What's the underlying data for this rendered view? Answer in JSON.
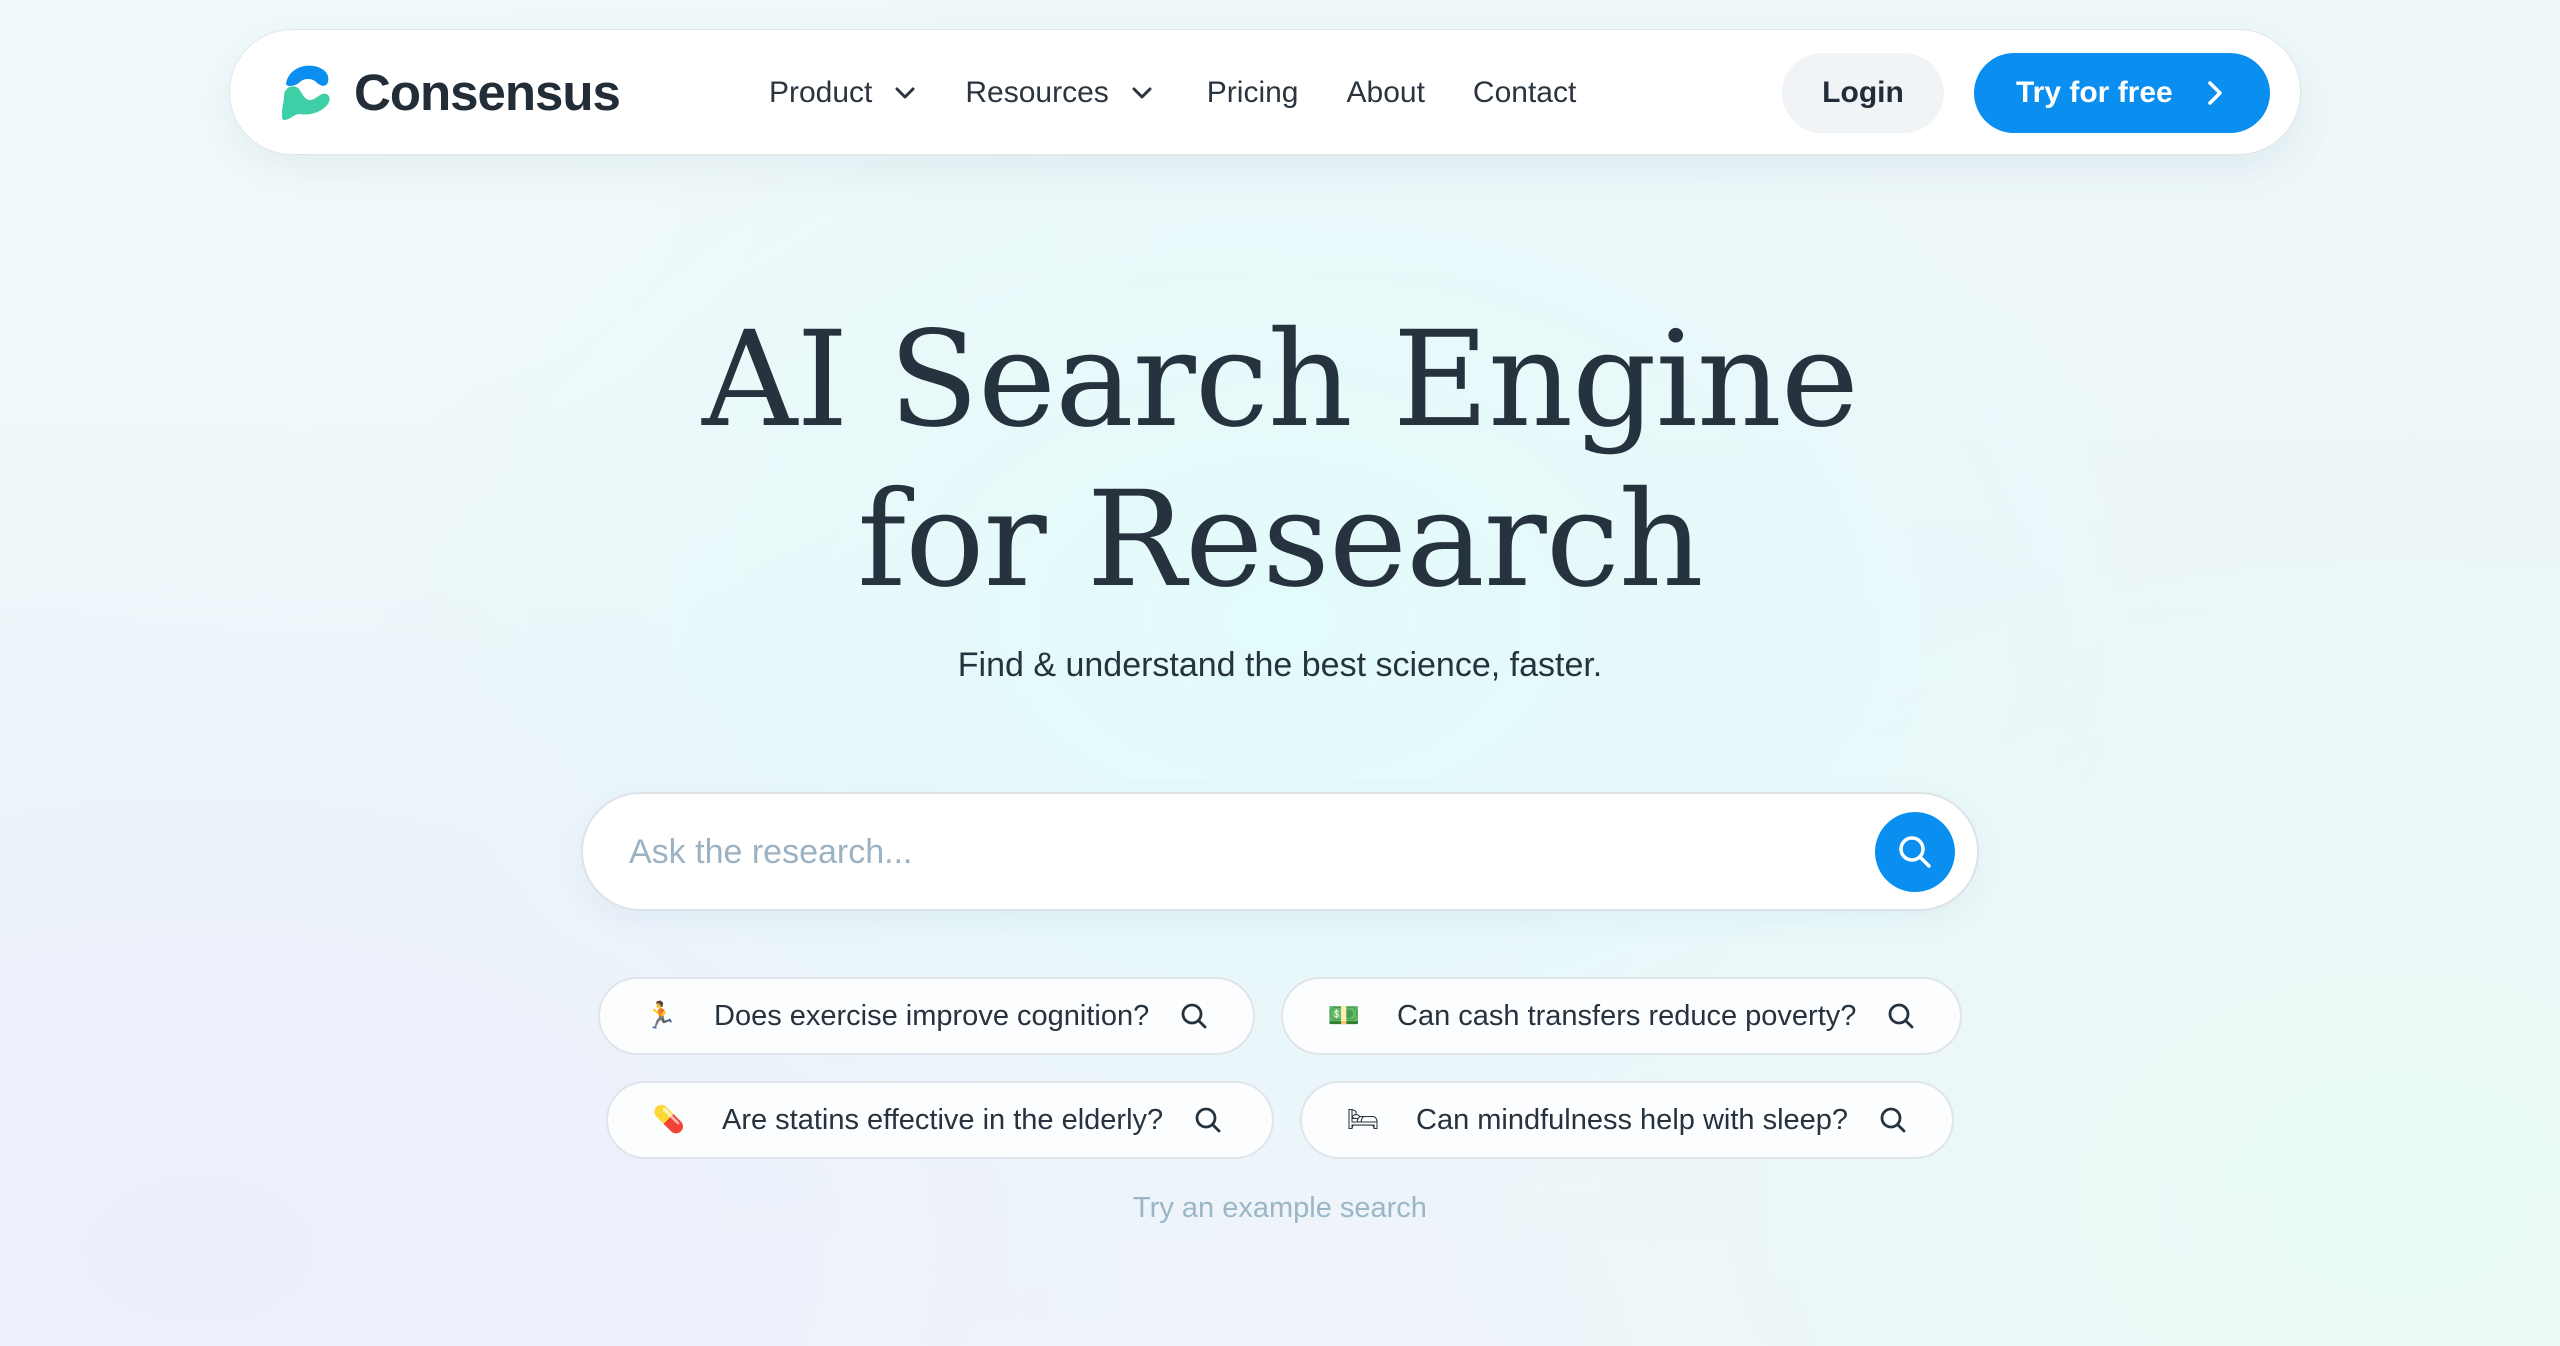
{
  "brand": {
    "name": "Consensus",
    "colors": {
      "primary": "#0a8ff0",
      "logo_blue": "#0a8ff0",
      "logo_green": "#3ecfa6",
      "text_dark": "#222d38"
    }
  },
  "nav": {
    "links": [
      {
        "label": "Product",
        "has_dropdown": true
      },
      {
        "label": "Resources",
        "has_dropdown": true
      },
      {
        "label": "Pricing",
        "has_dropdown": false
      },
      {
        "label": "About",
        "has_dropdown": false
      },
      {
        "label": "Contact",
        "has_dropdown": false
      }
    ],
    "login_label": "Login",
    "cta_label": "Try for free",
    "cta_icon": "chevron-right-icon",
    "dropdown_icon": "chevron-down-icon"
  },
  "hero": {
    "title_line1": "AI Search Engine",
    "title_line2": "for Research",
    "subtitle": "Find & understand the best science, faster."
  },
  "search": {
    "placeholder": "Ask the research...",
    "value": "",
    "button_icon": "search-icon"
  },
  "examples": [
    {
      "emoji": "🏃",
      "icon": "running-person-icon",
      "label": "Does exercise improve cognition?"
    },
    {
      "emoji": "💵",
      "icon": "dollar-banknote-icon",
      "label": "Can cash transfers reduce poverty?"
    },
    {
      "emoji": "💊",
      "icon": "pill-icon",
      "label": "Are statins effective in the elderly?"
    },
    {
      "emoji": "🛏",
      "icon": "bed-icon",
      "label": "Can mindfulness help with sleep?"
    }
  ],
  "hint": "Try an example search"
}
